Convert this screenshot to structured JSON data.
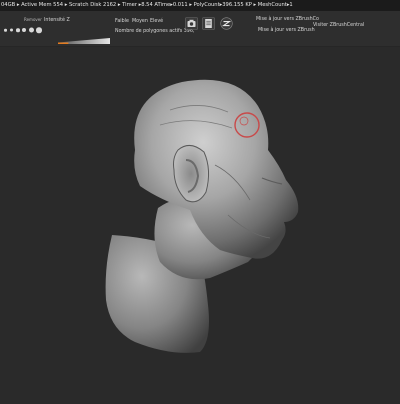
{
  "status_bar": {
    "text": "04GB ▸ Active Mem 554 ▸ Scratch Disk 2162 ▸ Timer ▸8.54 ATime▸0.011 ▸ PolyCount▸396.155 KP ▸ MeshCount▸1"
  },
  "toolbar": {
    "brush_label": "Remover",
    "intensity_label": "Intensité Z",
    "levels": {
      "low": "Faible",
      "medium": "Moyen",
      "high": "Elevé"
    },
    "polycount_label": "Nombre de polygones actifs 396,",
    "update_zbrushcore": "Mise à jour vers ZBrushCo",
    "update_zbrush": "Mise à jour vers ZBrush",
    "zbrushcentral": "Visiter ZBrushCentral",
    "intensity_value": 0.2
  },
  "colors": {
    "accent": "#e37b1f",
    "brush_cursor": "#c84a4a"
  },
  "icons": [
    "camera-icon",
    "document-icon",
    "zbrush-logo-icon"
  ]
}
